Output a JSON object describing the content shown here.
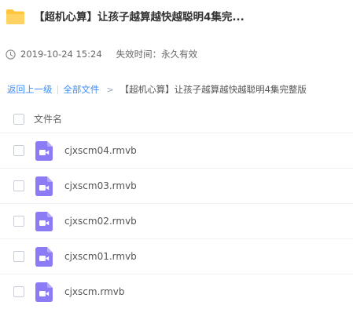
{
  "share": {
    "title": "【超机心算】让孩子越算越快越聪明4集完...",
    "date": "2019-10-24 15:24",
    "expiry": "失效时间：永久有效"
  },
  "breadcrumb": {
    "back": "返回上一级",
    "separator": "|",
    "all_files": "全部文件",
    "arrow": ">",
    "current": "【超机心算】让孩子越算越快越聪明4集完整版"
  },
  "table": {
    "header_label": "文件名"
  },
  "files": [
    {
      "name": "cjxscm04.rmvb"
    },
    {
      "name": "cjxscm03.rmvb"
    },
    {
      "name": "cjxscm02.rmvb"
    },
    {
      "name": "cjxscm01.rmvb"
    },
    {
      "name": "cjxscm.rmvb"
    }
  ],
  "icons": {
    "folder": "folder-icon",
    "clock": "clock-icon",
    "video": "video-file-icon",
    "checkbox": "checkbox"
  },
  "colors": {
    "link": "#3b8cff",
    "folder": "#ffc53d",
    "video_icon": "#8b7cf6",
    "text": "#333333"
  }
}
